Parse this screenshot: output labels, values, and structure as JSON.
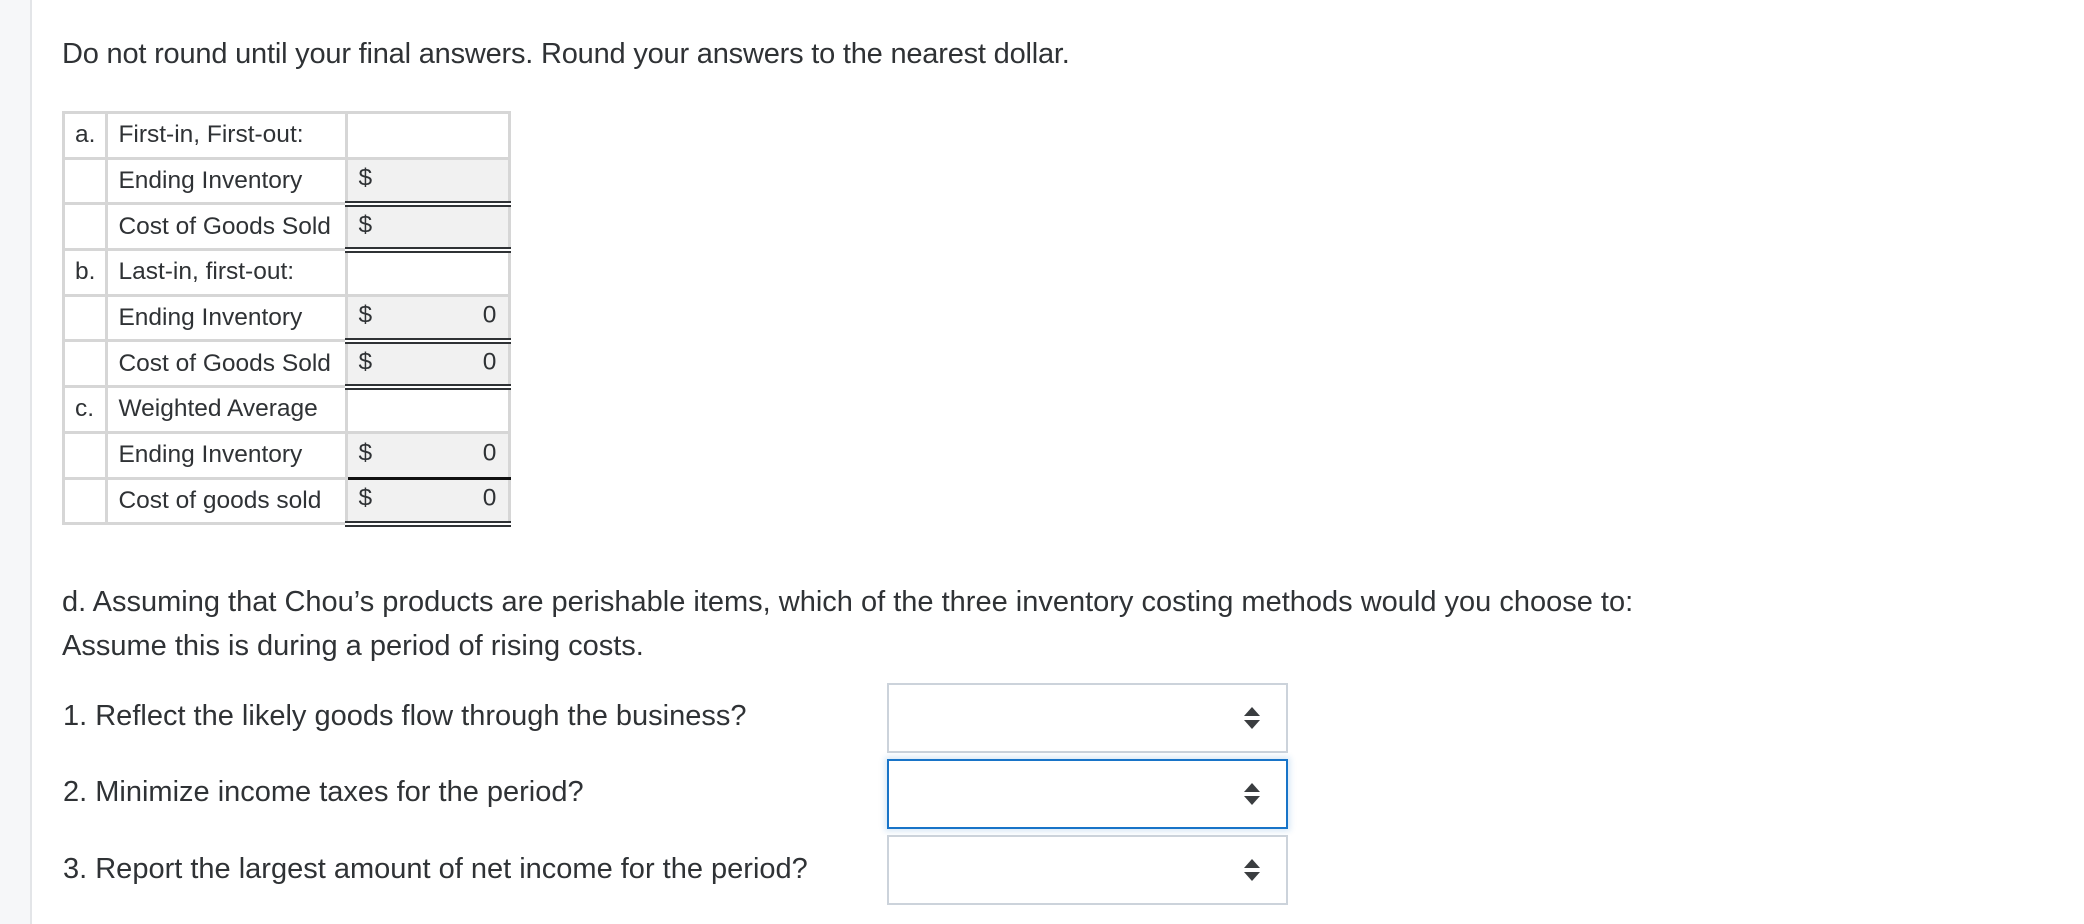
{
  "instruction": "Do not round until your final answers. Round your answers to the nearest dollar.",
  "table": {
    "sections": [
      {
        "letter": "a.",
        "title": "First-in, First-out:",
        "rows": [
          {
            "label": "Ending Inventory",
            "currency": "$",
            "value": ""
          },
          {
            "label": "Cost of Goods Sold",
            "currency": "$",
            "value": ""
          }
        ]
      },
      {
        "letter": "b.",
        "title": "Last-in, first-out:",
        "rows": [
          {
            "label": "Ending Inventory",
            "currency": "$",
            "value": "0"
          },
          {
            "label": "Cost of Goods Sold",
            "currency": "$",
            "value": "0"
          }
        ]
      },
      {
        "letter": "c.",
        "title": "Weighted Average",
        "rows": [
          {
            "label": "Ending Inventory",
            "currency": "$",
            "value": "0"
          },
          {
            "label": "Cost of goods sold",
            "currency": "$",
            "value": "0"
          }
        ]
      }
    ]
  },
  "part_d": {
    "line1": "d. Assuming that Chou’s products are perishable items, which of the three inventory costing methods would you choose to:",
    "line2": "Assume this is during a period of rising costs.",
    "questions": [
      {
        "text": "1. Reflect the likely goods flow through the business?",
        "selected": "",
        "focused": false
      },
      {
        "text": "2. Minimize income taxes for the period?",
        "selected": "",
        "focused": true
      },
      {
        "text": "3. Report the largest amount of net income for the period?",
        "selected": "",
        "focused": false
      }
    ]
  },
  "colors": {
    "focus_border": "#1874c8",
    "select_border": "#ccd3db",
    "input_bg": "#f1f1f1"
  }
}
